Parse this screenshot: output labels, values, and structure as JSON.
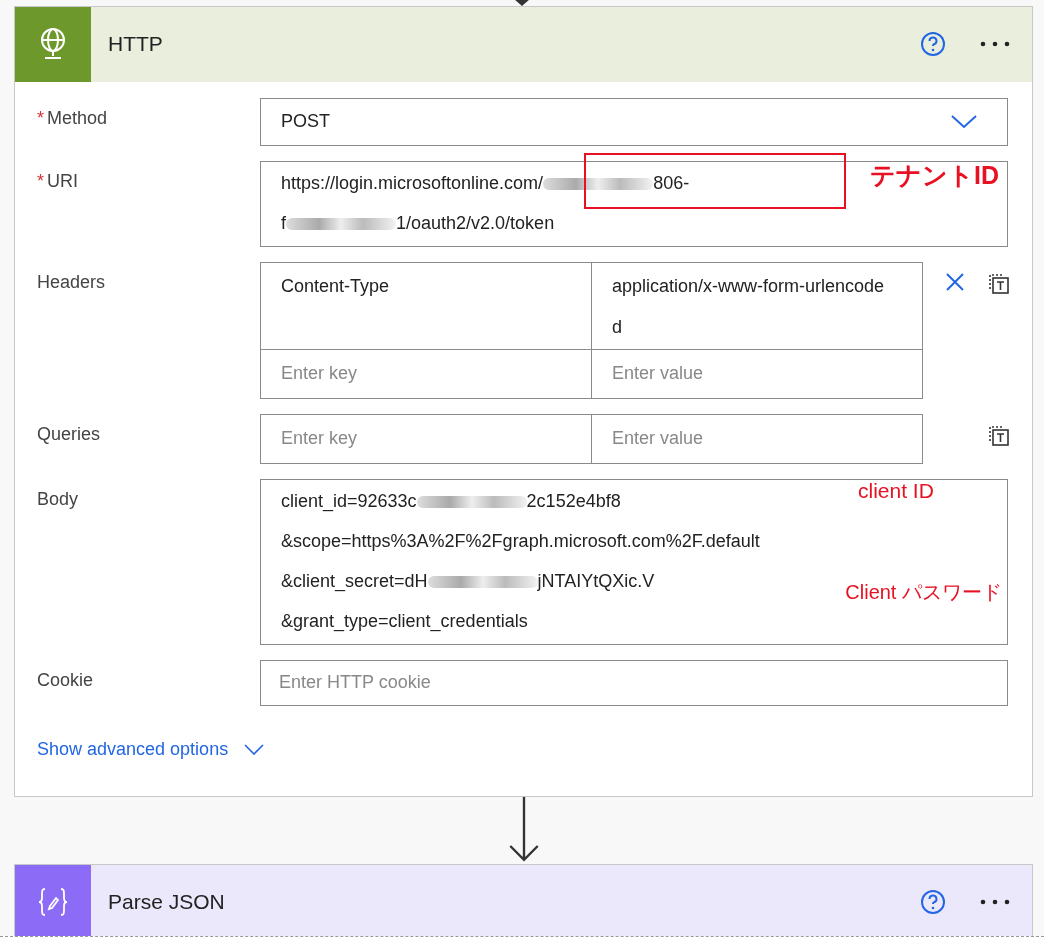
{
  "http_card": {
    "title": "HTTP",
    "fields": [
      {
        "kind": "select",
        "marker": "*",
        "label": "Method",
        "value": "POST"
      },
      {
        "kind": "multiline",
        "marker": "*",
        "label": "URI",
        "lines": [
          {
            "before": "https://login.microsoftonline.com/",
            "after": "806-"
          },
          {
            "before": "f",
            "after": "1/oauth2/v2.0/token"
          }
        ],
        "note": "テナントID"
      },
      {
        "kind": "pairs",
        "label": "Headers",
        "removable": true,
        "rows": [
          {
            "key": "Content-Type",
            "value": "application/x-www-form-urlencoded"
          },
          {
            "key_placeholder": "Enter key",
            "value_placeholder": "Enter value"
          }
        ]
      },
      {
        "kind": "pairs",
        "label": "Queries",
        "removable": false,
        "rows": [
          {
            "key_placeholder": "Enter key",
            "value_placeholder": "Enter value"
          }
        ]
      },
      {
        "kind": "multiline",
        "label": "Body",
        "lines": [
          {
            "before": "client_id=92633c",
            "after": "2c152e4bf8"
          },
          {
            "before": "&scope=https%3A%2F%2Fgraph.microsoft.com%2F.default"
          },
          {
            "before": "&client_secret=dH",
            "after": "jNTAIYtQXic.V"
          },
          {
            "before": "&grant_type=client_credentials"
          }
        ],
        "notes": [
          "client ID",
          "Client パスワード"
        ]
      },
      {
        "kind": "text",
        "label": "Cookie",
        "placeholder": "Enter HTTP cookie"
      }
    ],
    "advanced_link": "Show advanced options"
  },
  "next_card": {
    "title": "Parse JSON"
  }
}
